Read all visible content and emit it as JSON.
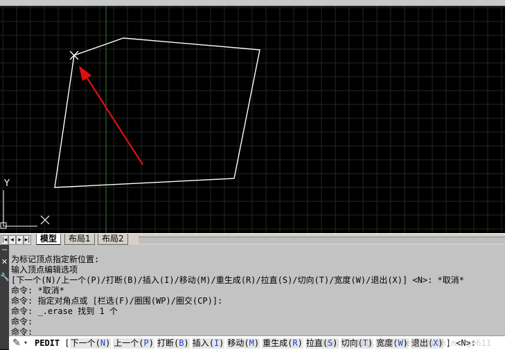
{
  "layout_tabs": [
    {
      "label": "模型",
      "active": true
    },
    {
      "label": "布局1",
      "active": false
    },
    {
      "label": "布局2",
      "active": false
    }
  ],
  "ucs_y_label": "Y",
  "colors": {
    "canvas_bg": "#000000",
    "grid": "#262626",
    "axis_green": "#2e7d32",
    "polyline": "#ffffff",
    "arrow": "#e01010",
    "cmd_bg": "#c3c3c3",
    "option_key": "#1c3fc9"
  },
  "command_history": [
    "为标记顶点指定新位置:",
    "输入顶点编辑选项",
    "[下一个(N)/上一个(P)/打断(B)/插入(I)/移动(M)/重生成(R)/拉直(S)/切向(T)/宽度(W)/退出(X)] <N>: *取消*",
    "命令: *取消*",
    "命令: 指定对角点或 [栏选(F)/圈围(WP)/圈交(CP)]:",
    "命令: _.erase 找到 1 个",
    "命令:",
    "命令:"
  ],
  "command_prompt": {
    "command": "PEDIT",
    "open_bracket": "[",
    "options": [
      {
        "label": "下一个",
        "key": "N"
      },
      {
        "label": "上一个",
        "key": "P"
      },
      {
        "label": "打断",
        "key": "B"
      },
      {
        "label": "插入",
        "key": "I"
      },
      {
        "label": "移动",
        "key": "M"
      },
      {
        "label": "重生成",
        "key": "R"
      },
      {
        "label": "拉直",
        "key": "S"
      },
      {
        "label": "切向",
        "key": "T"
      },
      {
        "label": "宽度",
        "key": "W"
      },
      {
        "label": "退出",
        "key": "X"
      }
    ],
    "close_bracket": "]",
    "default": "<N>:"
  },
  "watermark": "https://blog.csdn.net/zhuzhiming0611"
}
